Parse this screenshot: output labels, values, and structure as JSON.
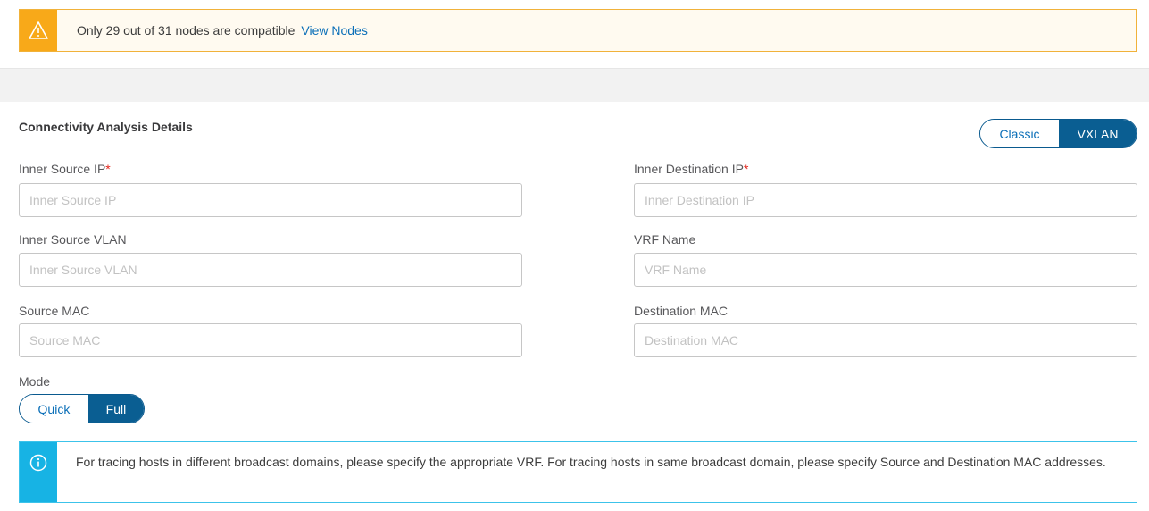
{
  "warning": {
    "message": "Only 29 out of 31 nodes are compatible",
    "link": "View Nodes",
    "icon": "warning-triangle-icon",
    "color": "#f8a919"
  },
  "section": {
    "title": "Connectivity Analysis Details"
  },
  "encapsulation_toggle": {
    "options": [
      "Classic",
      "VXLAN"
    ],
    "selected": "VXLAN"
  },
  "fields": {
    "inner_source_ip": {
      "label": "Inner Source IP",
      "required_mark": "*",
      "placeholder": "Inner Source IP",
      "value": ""
    },
    "inner_destination_ip": {
      "label": "Inner Destination IP",
      "required_mark": "*",
      "placeholder": "Inner Destination IP",
      "value": ""
    },
    "inner_source_vlan": {
      "label": "Inner Source VLAN",
      "placeholder": "Inner Source VLAN",
      "value": ""
    },
    "vrf_name": {
      "label": "VRF Name",
      "placeholder": "VRF Name",
      "value": ""
    },
    "source_mac": {
      "label": "Source MAC",
      "placeholder": "Source MAC",
      "value": ""
    },
    "destination_mac": {
      "label": "Destination MAC",
      "placeholder": "Destination MAC",
      "value": ""
    }
  },
  "mode": {
    "label": "Mode",
    "options": [
      "Quick",
      "Full"
    ],
    "selected": "Full"
  },
  "info": {
    "icon": "info-circle-icon",
    "color": "#17b3e4",
    "message": "For tracing hosts in different broadcast domains, please specify the appropriate VRF. For tracing hosts in same broadcast domain, please specify Source and Destination MAC addresses."
  }
}
